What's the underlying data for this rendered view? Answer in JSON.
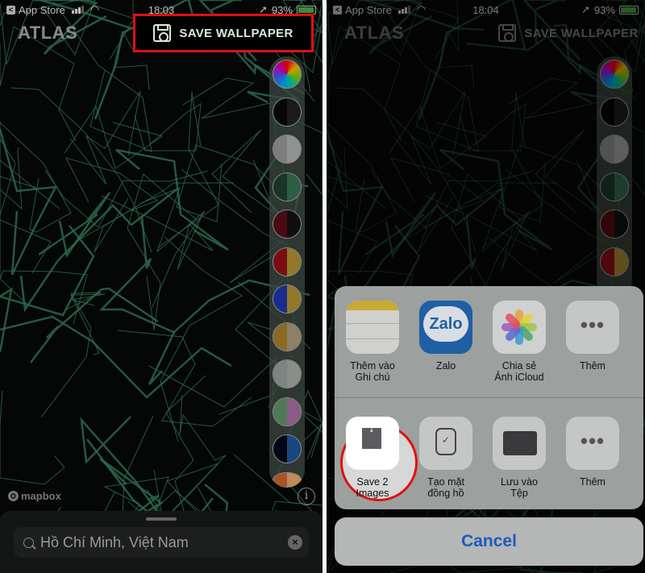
{
  "left": {
    "status": {
      "back_label": "App Store",
      "time": "18:03",
      "battery": "93%"
    },
    "app_title": "ATLAS",
    "save_label": "SAVE WALLPAPER",
    "attribution": "mapbox",
    "search": {
      "value": "Hồ Chí Minh, Việt Nam"
    }
  },
  "right": {
    "status": {
      "back_label": "App Store",
      "time": "18:04",
      "battery": "93%"
    },
    "app_title": "ATLAS",
    "save_label": "SAVE WALLPAPER",
    "share_row1": [
      {
        "label": "Thêm vào Ghi chú",
        "icon": "notes-icon"
      },
      {
        "label": "Zalo",
        "icon": "zalo-icon",
        "icon_text": "Zalo"
      },
      {
        "label": "Chia sẻ Ảnh iCloud",
        "icon": "photos-icon"
      },
      {
        "label": "Thêm",
        "icon": "more-icon"
      }
    ],
    "share_row2": [
      {
        "label": "Save 2 Images",
        "icon": "save-images-icon"
      },
      {
        "label": "Tạo mặt đồng hồ",
        "icon": "watch-face-icon"
      },
      {
        "label": "Lưu vào Tệp",
        "icon": "folder-icon"
      },
      {
        "label": "Thêm",
        "icon": "more-icon"
      }
    ],
    "cancel_label": "Cancel"
  },
  "palette": [
    [
      "rainbow",
      "rainbow"
    ],
    [
      "#060606",
      "#1b1b1b"
    ],
    [
      "#7e7e7e",
      "#8f9392"
    ],
    [
      "#1a3427",
      "#2e5c45"
    ],
    [
      "#4a0a14",
      "#0f0f0f"
    ],
    [
      "#7a0d14",
      "#94782a"
    ],
    [
      "#1a2d8c",
      "#94782a"
    ],
    [
      "#8a6a24",
      "#8c8066"
    ],
    [
      "#7e8482",
      "#8a8d8a"
    ],
    [
      "#4f7a58",
      "#8a5b86"
    ],
    [
      "#030715",
      "#184780"
    ],
    [
      "#a8532a",
      "#c08a5a"
    ]
  ],
  "colors": {
    "map_line": "#2e6b50",
    "highlight": "#e01010",
    "link": "#1c5bbf"
  }
}
